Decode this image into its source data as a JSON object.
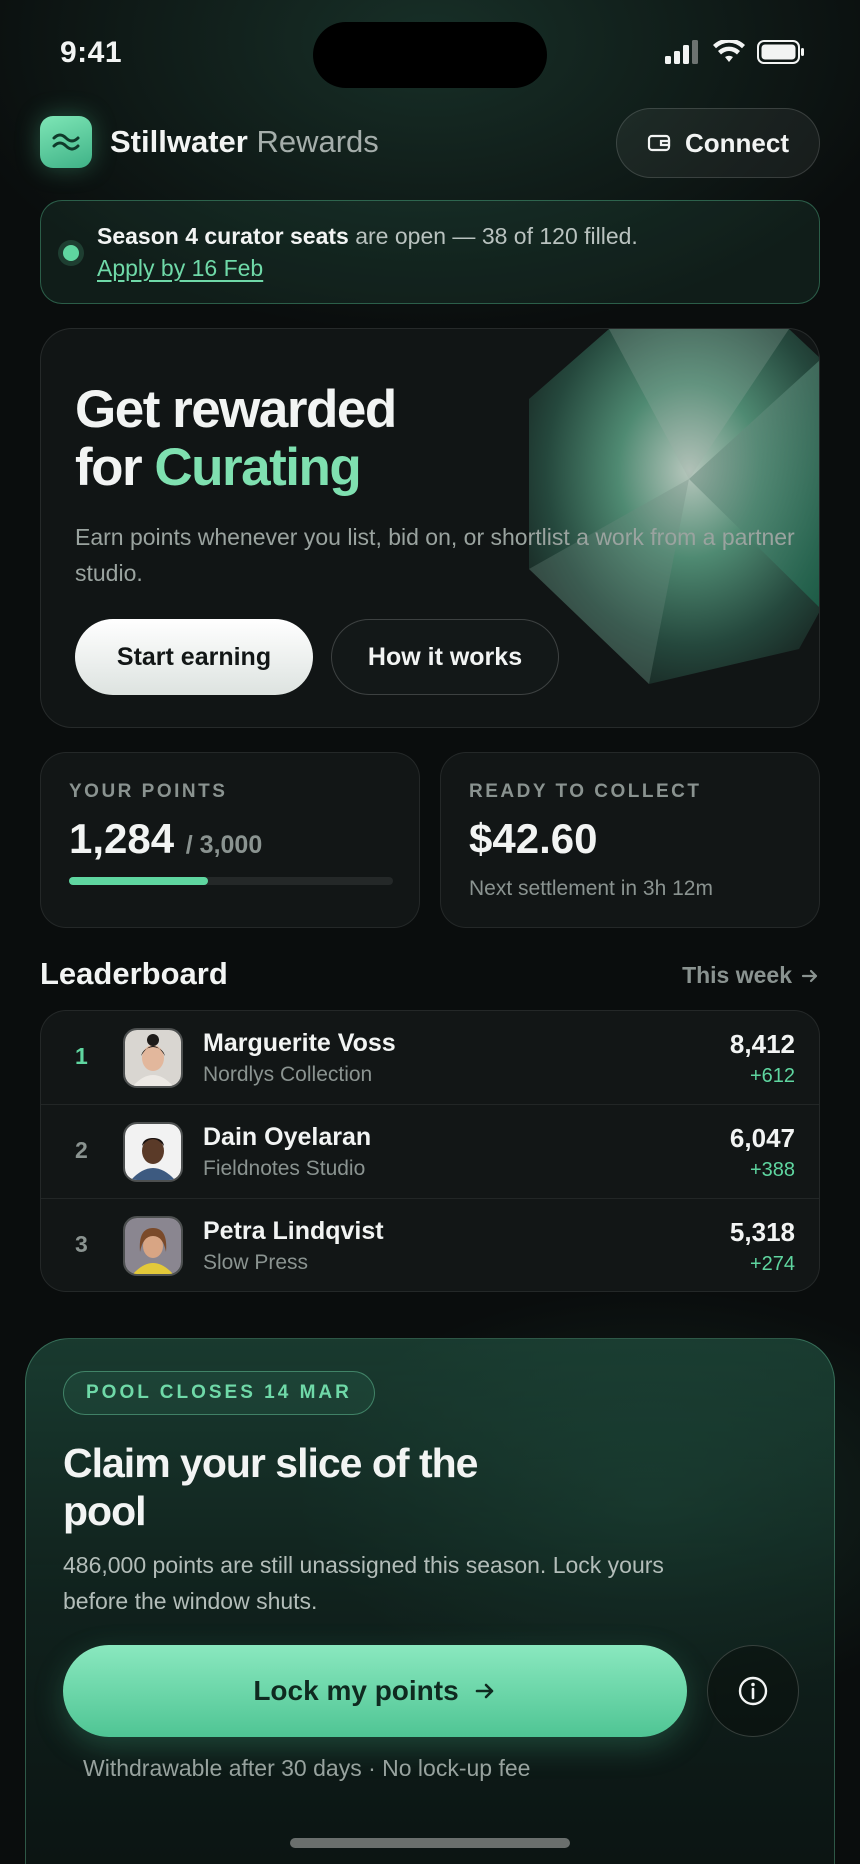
{
  "status_bar": {
    "time": "9:41",
    "icons": [
      "signal-icon",
      "wifi-icon",
      "battery-icon"
    ]
  },
  "header": {
    "brand_name": "Stillwater",
    "brand_suffix": "Rewards",
    "logo_icon": "wave-logo-icon",
    "connect_label": "Connect",
    "connect_icon": "wallet-icon"
  },
  "announcement": {
    "bold": "Season 4 curator seats",
    "text": " are open — 38 of 120 filled.",
    "link": "Apply by 16 Feb"
  },
  "hero": {
    "title_line1": "Get rewarded",
    "title_prefix": "for ",
    "title_accent": "Curating",
    "description": "Earn points whenever you list, bid on, or shortlist a work from a partner studio.",
    "primary_button": "Start earning",
    "secondary_button": "How it works"
  },
  "stats": {
    "points": {
      "label": "YOUR POINTS",
      "value": "1,284",
      "total": "/ 3,000",
      "progress_fraction": 0.428
    },
    "collect": {
      "label": "READY TO COLLECT",
      "value": "$42.60",
      "note": "Next settlement in 3h 12m"
    }
  },
  "leaderboard": {
    "title": "Leaderboard",
    "period_link": "This week",
    "rows": [
      {
        "rank": "1",
        "name": "Marguerite Voss",
        "studio": "Nordlys Collection",
        "points": "8,412",
        "delta": "+612"
      },
      {
        "rank": "2",
        "name": "Dain Oyelaran",
        "studio": "Fieldnotes Studio",
        "points": "6,047",
        "delta": "+388"
      },
      {
        "rank": "3",
        "name": "Petra Lindqvist",
        "studio": "Slow Press",
        "points": "5,318",
        "delta": "+274"
      }
    ]
  },
  "pool": {
    "badge": "POOL CLOSES 14 MAR",
    "title": "Claim your slice of the pool",
    "description": "486,000 points are still unassigned this season. Lock yours before the window shuts.",
    "cta": "Lock my points",
    "info_icon": "info-icon",
    "footnote": "Withdrawable after 30 days · No lock-up fee"
  },
  "colors": {
    "accent": "#5fd6a0",
    "background": "#0a0d0d",
    "card": "#121616"
  }
}
